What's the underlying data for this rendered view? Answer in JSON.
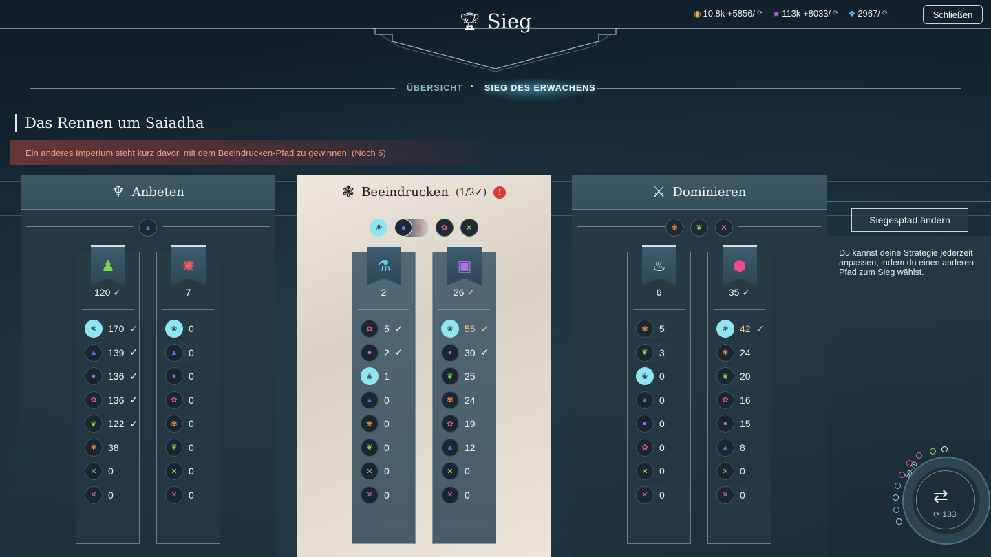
{
  "header": {
    "title": "Sieg",
    "close_label": "Schließen",
    "resources": [
      {
        "icon": "dust-coin-icon",
        "text": "10.8k +5856/",
        "color": "#e7b54a"
      },
      {
        "icon": "influence-star-icon",
        "text": "113k +8033/",
        "color": "#b06be0"
      },
      {
        "icon": "science-icon",
        "text": "2967/",
        "color": "#6fb7e0"
      }
    ]
  },
  "tabs": [
    {
      "label": "ÜBERSICHT",
      "active": false
    },
    {
      "label": "SIEG DES ERWACHENS",
      "active": true
    }
  ],
  "section": {
    "title": "Das Rennen um Saiadha",
    "alert": "Ein anderes Imperium steht kurz davor, mit dem Beeindrucken-Pfad zu gewinnen! (Noch 6)"
  },
  "paths": [
    {
      "name": "Anbeten",
      "count": "",
      "icon": "worship-icon",
      "requirements": [
        {
          "icon": "tower-icon",
          "value": ""
        }
      ],
      "columns": [
        {
          "icon": "person-icon",
          "icon_color": "#7bd64a",
          "score": "120",
          "done": true,
          "rows": [
            {
              "icon": "wisdom-icon",
              "color": "#8fe6f0",
              "value": "170",
              "check": "gold",
              "hl": false
            },
            {
              "icon": "tower-icon",
              "color": "#5b6fd8",
              "value": "139",
              "check": "white",
              "hl": false
            },
            {
              "icon": "orb-icon",
              "color": "#a36be0",
              "value": "136",
              "check": "white",
              "hl": false
            },
            {
              "icon": "rose-icon",
              "color": "#e05a7a",
              "value": "136",
              "check": "white",
              "hl": false
            },
            {
              "icon": "leaf-icon",
              "color": "#7bd64a",
              "value": "122",
              "check": "white",
              "hl": false
            },
            {
              "icon": "flower-icon",
              "color": "#f0904a",
              "value": "38",
              "check": "",
              "hl": false
            },
            {
              "icon": "cross-swords-icon",
              "color": "#9ad46a",
              "value": "0",
              "check": "",
              "hl": false
            },
            {
              "icon": "swords-icon",
              "color": "#d070d0",
              "value": "0",
              "check": "",
              "hl": false
            }
          ]
        },
        {
          "icon": "spiral-icon",
          "icon_color": "#f06060",
          "score": "7",
          "done": false,
          "rows": [
            {
              "icon": "wisdom-icon",
              "color": "#8fe6f0",
              "value": "0",
              "check": "",
              "hl": false
            },
            {
              "icon": "tower-icon",
              "color": "#5b6fd8",
              "value": "0",
              "check": "",
              "hl": true
            },
            {
              "icon": "orb-icon",
              "color": "#a36be0",
              "value": "0",
              "check": "",
              "hl": false
            },
            {
              "icon": "rose-icon",
              "color": "#e05a7a",
              "value": "0",
              "check": "",
              "hl": false
            },
            {
              "icon": "flower-icon",
              "color": "#f0904a",
              "value": "0",
              "check": "",
              "hl": false
            },
            {
              "icon": "leaf-icon",
              "color": "#7bd64a",
              "value": "0",
              "check": "",
              "hl": false
            },
            {
              "icon": "cross-swords-icon",
              "color": "#9ad46a",
              "value": "0",
              "check": "",
              "hl": false
            },
            {
              "icon": "swords-icon",
              "color": "#d070d0",
              "value": "0",
              "check": "",
              "hl": false
            }
          ]
        }
      ]
    },
    {
      "name": "Beeindrucken",
      "count": "(1/2✓)",
      "icon": "impress-icon",
      "requirements": [
        {
          "icon": "wisdom-icon",
          "value": ""
        },
        {
          "icon": "orb-icon",
          "value": "6"
        },
        {
          "icon": "rose-icon",
          "value": ""
        },
        {
          "icon": "cross-swords-icon",
          "value": ""
        }
      ],
      "columns": [
        {
          "icon": "potion-icon",
          "icon_color": "#6fc8f0",
          "score": "2",
          "done": false,
          "rows": [
            {
              "icon": "rose-icon",
              "color": "#e05a7a",
              "value": "5",
              "check": "white",
              "hl": true
            },
            {
              "icon": "orb-icon",
              "color": "#a36be0",
              "value": "2",
              "check": "white",
              "hl": false
            },
            {
              "icon": "wisdom-icon",
              "color": "#8fe6f0",
              "value": "1",
              "check": "",
              "hl": true
            },
            {
              "icon": "tower-icon",
              "color": "#5b6fd8",
              "value": "0",
              "check": "",
              "hl": false
            },
            {
              "icon": "flower-icon",
              "color": "#f0904a",
              "value": "0",
              "check": "",
              "hl": false
            },
            {
              "icon": "leaf-icon",
              "color": "#7bd64a",
              "value": "0",
              "check": "",
              "hl": false
            },
            {
              "icon": "cross-swords-icon",
              "color": "#9ad46a",
              "value": "0",
              "check": "",
              "hl": true
            },
            {
              "icon": "swords-icon",
              "color": "#d070d0",
              "value": "0",
              "check": "",
              "hl": false
            }
          ]
        },
        {
          "icon": "chat-icon",
          "icon_color": "#b070e8",
          "score": "26",
          "done": true,
          "rows": [
            {
              "icon": "wisdom-icon",
              "color": "#8fe6f0",
              "value": "55",
              "check": "gold",
              "hl": true,
              "gold": true
            },
            {
              "icon": "orb-icon",
              "color": "#a36be0",
              "value": "30",
              "check": "white",
              "hl": false
            },
            {
              "icon": "leaf-icon",
              "color": "#7bd64a",
              "value": "25",
              "check": "",
              "hl": false
            },
            {
              "icon": "flower-icon",
              "color": "#f0904a",
              "value": "24",
              "check": "",
              "hl": false
            },
            {
              "icon": "rose-icon",
              "color": "#e05a7a",
              "value": "19",
              "check": "",
              "hl": true
            },
            {
              "icon": "tower-icon",
              "color": "#5b6fd8",
              "value": "12",
              "check": "",
              "hl": false
            },
            {
              "icon": "cross-swords-icon",
              "color": "#9ad46a",
              "value": "0",
              "check": "",
              "hl": true
            },
            {
              "icon": "swords-icon",
              "color": "#d070d0",
              "value": "0",
              "check": "",
              "hl": false
            }
          ]
        }
      ]
    },
    {
      "name": "Dominieren",
      "count": "",
      "icon": "dominate-icon",
      "requirements": [
        {
          "icon": "flower-icon",
          "value": ""
        },
        {
          "icon": "leaf-icon",
          "value": ""
        },
        {
          "icon": "swords-icon",
          "value": ""
        }
      ],
      "columns": [
        {
          "icon": "fire-icon",
          "icon_color": "#f3f6f8",
          "score": "6",
          "done": false,
          "rows": [
            {
              "icon": "flower-icon",
              "color": "#f0904a",
              "value": "5",
              "check": "",
              "hl": true
            },
            {
              "icon": "leaf-icon",
              "color": "#7bd64a",
              "value": "3",
              "check": "",
              "hl": true
            },
            {
              "icon": "wisdom-icon",
              "color": "#8fe6f0",
              "value": "0",
              "check": "",
              "hl": false
            },
            {
              "icon": "tower-icon",
              "color": "#5b6fd8",
              "value": "0",
              "check": "",
              "hl": false
            },
            {
              "icon": "orb-icon",
              "color": "#a36be0",
              "value": "0",
              "check": "",
              "hl": false
            },
            {
              "icon": "rose-icon",
              "color": "#e05a7a",
              "value": "0",
              "check": "",
              "hl": false
            },
            {
              "icon": "cross-swords-icon",
              "color": "#9ad46a",
              "value": "0",
              "check": "",
              "hl": false
            },
            {
              "icon": "swords-icon",
              "color": "#d070d0",
              "value": "0",
              "check": "",
              "hl": true
            }
          ]
        },
        {
          "icon": "hex-cluster-icon",
          "icon_color": "#f04a8a",
          "score": "35",
          "done": true,
          "rows": [
            {
              "icon": "wisdom-icon",
              "color": "#8fe6f0",
              "value": "42",
              "check": "gold",
              "hl": false,
              "gold": true
            },
            {
              "icon": "flower-icon",
              "color": "#f0904a",
              "value": "24",
              "check": "",
              "hl": false
            },
            {
              "icon": "leaf-icon",
              "color": "#7bd64a",
              "value": "20",
              "check": "",
              "hl": true
            },
            {
              "icon": "rose-icon",
              "color": "#e05a7a",
              "value": "16",
              "check": "",
              "hl": false
            },
            {
              "icon": "orb-icon",
              "color": "#a36be0",
              "value": "15",
              "check": "",
              "hl": false
            },
            {
              "icon": "tower-icon",
              "color": "#5b6fd8",
              "value": "8",
              "check": "",
              "hl": false
            },
            {
              "icon": "cross-swords-icon",
              "color": "#9ad46a",
              "value": "0",
              "check": "",
              "hl": false
            },
            {
              "icon": "swords-icon",
              "color": "#d070d0",
              "value": "0",
              "check": "",
              "hl": true
            }
          ]
        }
      ]
    }
  ],
  "side": {
    "change_label": "Siegespfad ändern",
    "description": "Du kannst deine Strategie jederzeit anpassen, indem du einen anderen Pfad zum Sieg wählst."
  },
  "dial": {
    "range": "59-79",
    "turn": "183"
  }
}
